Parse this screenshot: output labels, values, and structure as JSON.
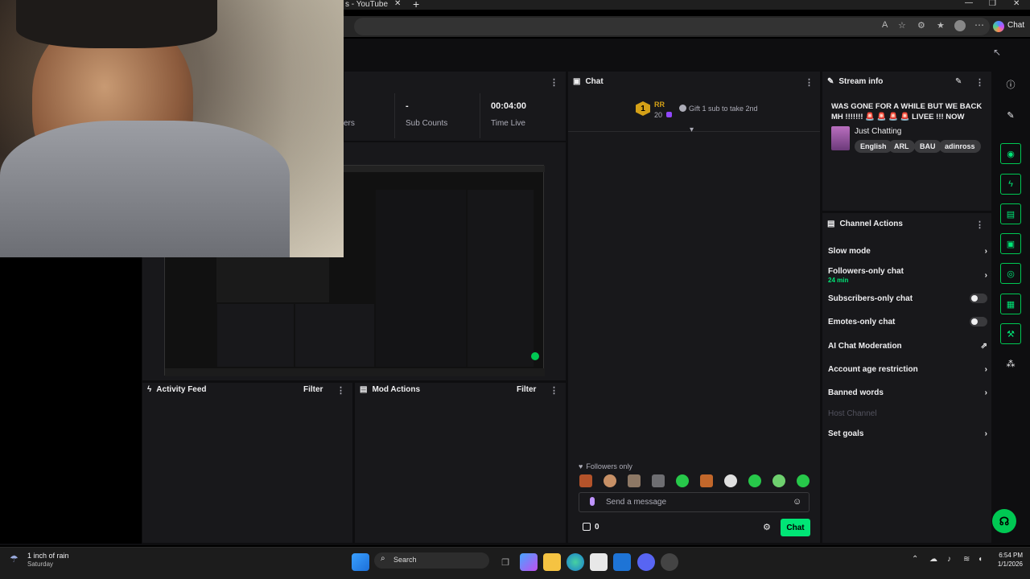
{
  "browser": {
    "tab_title": "s - YouTube",
    "tab_close": "✕",
    "new_tab": "+",
    "copilot_label": "Chat"
  },
  "stats": {
    "followers_partial": "ers",
    "sub_counts_value": "-",
    "sub_counts_label": "Sub Counts",
    "time_live_value": "00:04:00",
    "time_live_label": "Time Live"
  },
  "chat": {
    "title": "Chat",
    "gift_user": "RR",
    "gift_rank": "1",
    "gift_count": "20",
    "gift_text": "Gift 1 sub to take 2nd",
    "followers_only_label": "Followers only",
    "input_placeholder": "Send a message",
    "points": "0",
    "send_label": "Chat"
  },
  "stream_info": {
    "title": "Stream info",
    "stream_title": "WAS GONE FOR A WHILE BUT WE BACK MH !!!!!!! 🚨 🚨 🚨 🚨 LIVEE !!! NOW !!!!!...",
    "category": "Just Chatting",
    "tags": [
      "English",
      "ARL",
      "BAU",
      "adinross"
    ]
  },
  "channel_actions": {
    "title": "Channel Actions",
    "slow_mode": "Slow mode",
    "followers_only_chat": "Followers-only chat",
    "followers_only_duration": "24 min",
    "subscribers_only_chat": "Subscribers-only chat",
    "emotes_only_chat": "Emotes-only chat",
    "ai_moderation": "AI Chat Moderation",
    "account_age": "Account age restriction",
    "banned_words": "Banned words",
    "host_channel": "Host Channel",
    "set_goals": "Set goals"
  },
  "activity_feed": {
    "title": "Activity Feed",
    "filter": "Filter"
  },
  "mod_actions": {
    "title": "Mod Actions",
    "filter": "Filter"
  },
  "taskbar": {
    "weather_main": "1 inch of rain",
    "weather_sub": "Saturday",
    "search_label": "Search",
    "time": "6:54 PM",
    "date": "1/1/2026"
  },
  "colors": {
    "accent": "#00e676",
    "panel": "#18181b",
    "page": "#0e0e10"
  }
}
